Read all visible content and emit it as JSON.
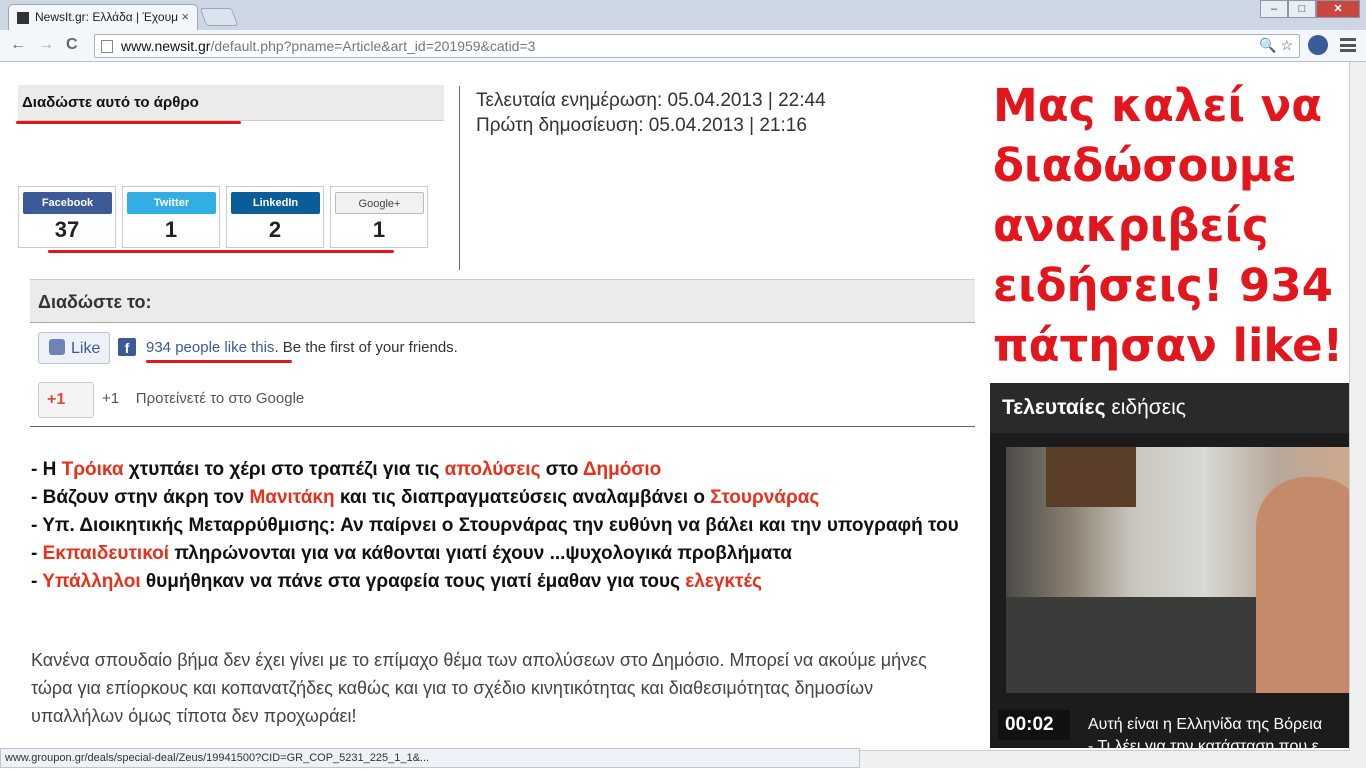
{
  "browser": {
    "tab_title": "NewsIt.gr: Ελλάδα | Έχουμ",
    "tab_close": "×",
    "url_host": "www.newsit.gr",
    "url_path": "/default.php?pname=Article&art_id=201959&catid=3",
    "back": "←",
    "forward": "→",
    "reload": "C",
    "window": {
      "minimize": "–",
      "maximize": "□",
      "close": "✕"
    }
  },
  "article": {
    "share_heading": "Διαδώστε αυτό το άρθρο",
    "updated": "Τελευταία ενημέρωση: 05.04.2013 | 22:44",
    "published": "Πρώτη δημοσίευση: 05.04.2013 | 21:16",
    "share_buttons": [
      {
        "label": "Facebook",
        "count": "37"
      },
      {
        "label": "Twitter",
        "count": "1"
      },
      {
        "label": "LinkedIn",
        "count": "2"
      },
      {
        "label": "Google+",
        "count": "1"
      }
    ],
    "spread_heading": "Διαδώστε το:",
    "like_label": "Like",
    "likes_count_text": "934 people like this",
    "likes_suffix": ". Be the first of your friends.",
    "gplus_label": "+1",
    "gplus_count": "+1",
    "gplus_note": "Προτείνετέ το στο Google",
    "bullets": [
      {
        "parts": [
          [
            "- Η ",
            false
          ],
          [
            "Τρόικα",
            true
          ],
          [
            " χτυπάει το χέρι στο τραπέζι για τις ",
            false
          ],
          [
            "απολύσεις",
            true
          ],
          [
            " στο ",
            false
          ],
          [
            "Δημόσιο",
            true
          ]
        ]
      },
      {
        "parts": [
          [
            "- Βάζουν στην άκρη τον ",
            false
          ],
          [
            "Μανιτάκη",
            true
          ],
          [
            " και τις διαπραγματεύσεις αναλαμβάνει ο ",
            false
          ],
          [
            "Στουρνάρας",
            true
          ]
        ]
      },
      {
        "parts": [
          [
            "- Υπ. Διοικητικής Μεταρρύθμισης: Αν παίρνει ο Στουρνάρας την ευθύνη να βάλει και την υπογραφή του",
            false
          ]
        ]
      },
      {
        "parts": [
          [
            "- ",
            false
          ],
          [
            "Εκπαιδευτικοί",
            true
          ],
          [
            " πληρώνονται για να κάθονται γιατί έχουν ...ψυχολογικά προβλήματα",
            false
          ]
        ]
      },
      {
        "parts": [
          [
            "- ",
            false
          ],
          [
            "Υπάλληλοι",
            true
          ],
          [
            " θυμήθηκαν να πάνε στα γραφεία τους γιατί έμαθαν για τους ",
            false
          ],
          [
            "ελεγκτές",
            true
          ]
        ]
      }
    ],
    "paragraph": "Κανένα σπουδαίο βήμα δεν έχει γίνει με το επίμαχο θέμα των απολύσεων στο Δημόσιο. Μπορεί να ακούμε μήνες τώρα για επίορκους και κοπανατζήδες καθώς και για το σχέδιο κινητικότητας και διαθεσιμότητας δημοσίων υπαλλήλων όμως τίποτα δεν προχωράει!"
  },
  "annotation": {
    "text": "Μας καλεί να διαδώσουμε ανακριβείς ειδήσεις! 934 πάτησαν like!",
    "color": "#e3161e"
  },
  "latest_news": {
    "heading_bold": "Τελευταίες",
    "heading_rest": " ειδήσεις",
    "duration": "00:02",
    "item1": "Αυτή είναι η Ελληνίδα της Βόρεια",
    "item2": "- Τι λέει για την κατάσταση που ε"
  },
  "status_bar": {
    "url": "www.groupon.gr/deals/special-deal/Zeus/19941500?CID=GR_COP_5231_225_1_1&..."
  },
  "colors": {
    "highlight": "#e8311c",
    "facebook": "#3c5a98",
    "twitter": "#33aee4",
    "linkedin": "#0b5d99"
  }
}
